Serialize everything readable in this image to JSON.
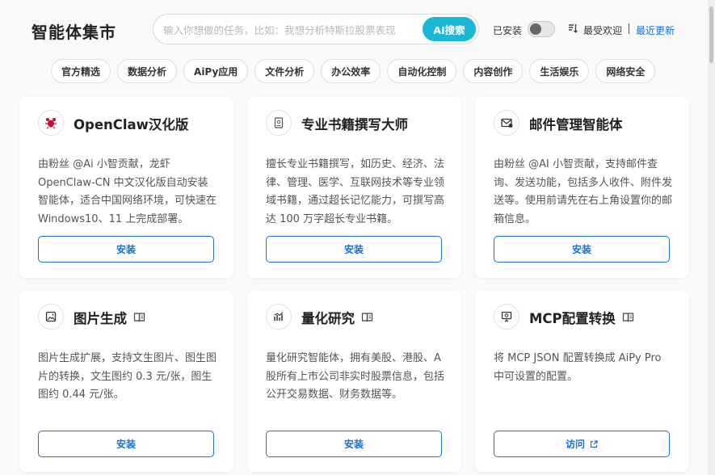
{
  "header": {
    "title": "智能体集市",
    "search": {
      "placeholder": "输入你想做的任务，比如：我想分析特斯拉股票表现",
      "value": "",
      "button_label": "AI搜索"
    },
    "installed_filter": {
      "label": "已安装",
      "enabled": false
    },
    "sort": {
      "popular_label": "最受欢迎",
      "recent_label": "最近更新",
      "active": "recent"
    }
  },
  "categories": [
    "官方精选",
    "数据分析",
    "AiPy应用",
    "文件分析",
    "办公效率",
    "自动化控制",
    "内容创作",
    "生活娱乐",
    "网络安全"
  ],
  "cards": [
    {
      "icon": "lobster-icon",
      "title": "OpenClaw汉化版",
      "has_badge": false,
      "description": "由粉丝 @Ai 小智贡献，龙虾OpenClaw-CN 中文汉化版自动安装智能体，适合中国网络环境，可快速在Windows10、11 上完成部署。",
      "button_label": "安装"
    },
    {
      "icon": "book-writer-icon",
      "title": "专业书籍撰写大师",
      "has_badge": false,
      "description": "擅长专业书籍撰写，如历史、经济、法律、管理、医学、互联网技术等专业领域书籍，通过超长记忆能力，可撰写高达 100 万字超长专业书籍。",
      "button_label": "安装"
    },
    {
      "icon": "mail-icon",
      "title": "邮件管理智能体",
      "has_badge": false,
      "description": "由粉丝 @AI 小智贡献，支持邮件查询、发送功能，包括多人收件、附件发送等。使用前请先在右上角设置你的邮箱信息。",
      "button_label": "安装"
    },
    {
      "icon": "image-icon",
      "title": "图片生成",
      "has_badge": true,
      "description": "图片生成扩展，支持文生图片、图生图片的转换，文生图约 0.3 元/张，图生图约 0.44 元/张。",
      "button_label": "安装"
    },
    {
      "icon": "chart-icon",
      "title": "量化研究",
      "has_badge": true,
      "description": "量化研究智能体，拥有美股、港股、A 股所有上市公司非实时股票信息，包括公开交易数据、财务数据等。",
      "button_label": "安装"
    },
    {
      "icon": "config-icon",
      "title": "MCP配置转换",
      "has_badge": true,
      "description": "将 MCP JSON 配置转换成 AiPy Pro 中可设置的配置。",
      "button_label": "访问",
      "button_icon": "external-link-icon"
    }
  ],
  "colors": {
    "accent": "#1a6fd1",
    "search_button": "#18b8d6",
    "brand_red": "#c8102e"
  }
}
